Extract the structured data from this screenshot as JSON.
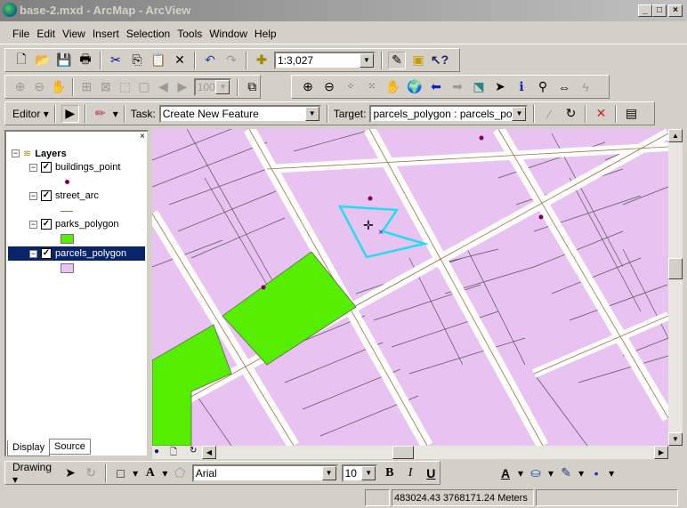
{
  "window": {
    "title": "base-2.mxd - ArcMap - ArcView",
    "controls": [
      "_",
      "□",
      "×"
    ]
  },
  "menu": [
    "File",
    "Edit",
    "View",
    "Insert",
    "Selection",
    "Tools",
    "Window",
    "Help"
  ],
  "standard_toolbar": {
    "scale": "1:3,027",
    "icons": [
      "new-icon",
      "open-icon",
      "save-icon",
      "print-icon",
      "cut-icon",
      "copy-icon",
      "paste-icon",
      "delete-icon",
      "undo-icon",
      "redo-icon",
      "add-data-icon",
      "editor-toolbar-icon",
      "arctoolbox-icon",
      "whats-this-icon"
    ]
  },
  "layout_toolbar": {
    "zoom_percent": "100%"
  },
  "editor_toolbar": {
    "editor_label": "Editor",
    "task_label": "Task:",
    "task_value": "Create New Feature",
    "target_label": "Target:",
    "target_value": "parcels_polygon : parcels_polyç"
  },
  "toc": {
    "root": "Layers",
    "layers": [
      {
        "name": "buildings_point",
        "checked": true,
        "symbol": "point",
        "color": "#800060"
      },
      {
        "name": "street_arc",
        "checked": true,
        "symbol": "line",
        "color": "#a07040"
      },
      {
        "name": "parks_polygon",
        "checked": true,
        "symbol": "fill",
        "color": "#55ee00"
      },
      {
        "name": "parcels_polygon",
        "checked": true,
        "symbol": "fill",
        "color": "#e8c2f0",
        "selected": true
      }
    ],
    "tabs": [
      "Display",
      "Source"
    ]
  },
  "drawing_toolbar": {
    "label": "Drawing",
    "font": "Arial",
    "size": "10",
    "bold": "B",
    "italic": "I",
    "underline": "U"
  },
  "status": {
    "coordinates": "483024.43  3768171.24 Meters"
  },
  "colors": {
    "parcel": "#e8c2f0",
    "park": "#55ee00",
    "sketch": "#22ddee",
    "street_line": "#a07040"
  }
}
